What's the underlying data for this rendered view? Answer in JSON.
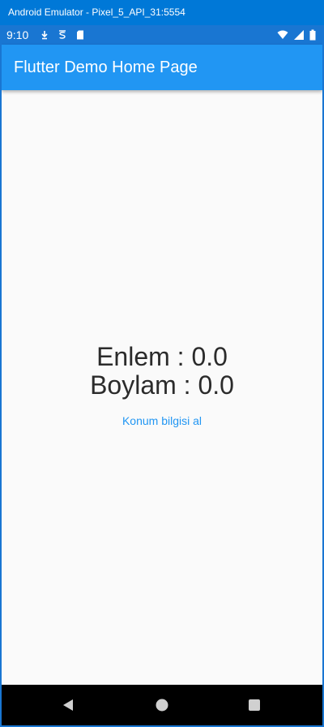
{
  "window": {
    "title": "Android Emulator - Pixel_5_API_31:5554"
  },
  "status_bar": {
    "time": "9:10",
    "left_icons": [
      "download-icon",
      "sim-s-icon",
      "sd-card-icon"
    ],
    "right_icons": [
      "wifi-icon",
      "cellular-signal-icon",
      "battery-icon"
    ]
  },
  "app_bar": {
    "title": "Flutter Demo Home Page",
    "color": "#2196f3"
  },
  "main": {
    "latitude_text": "Enlem : 0.0",
    "longitude_text": "Boylam : 0.0",
    "get_location_label": "Konum bilgisi al"
  },
  "nav_bar": {
    "buttons": [
      "back-icon",
      "home-icon",
      "overview-icon"
    ]
  },
  "colors": {
    "primary": "#2196f3",
    "primary_dark": "#1976d2",
    "background": "#fafafa",
    "emulator_frame": "#0078d7"
  }
}
